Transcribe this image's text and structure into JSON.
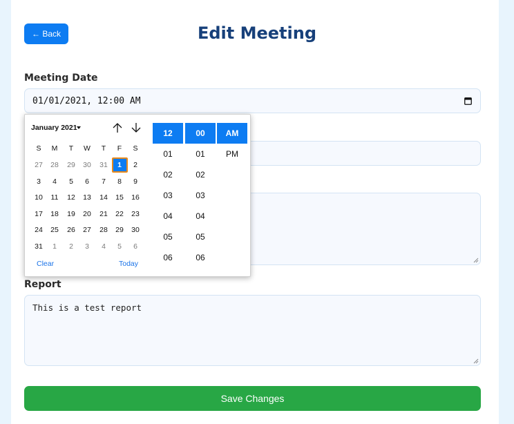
{
  "header": {
    "back_label": "← Back",
    "title": "Edit Meeting"
  },
  "form": {
    "meeting_date_label": "Meeting Date",
    "meeting_date_value": "01/01/2021, 12:00 AM",
    "report_label": "Report",
    "report_value": "This is a test report",
    "save_label": "Save Changes"
  },
  "picker": {
    "month_label": "January 2021",
    "weekdays": [
      "S",
      "M",
      "T",
      "W",
      "T",
      "F",
      "S"
    ],
    "weeks": [
      [
        {
          "d": "27",
          "o": true
        },
        {
          "d": "28",
          "o": true
        },
        {
          "d": "29",
          "o": true
        },
        {
          "d": "30",
          "o": true
        },
        {
          "d": "31",
          "o": true
        },
        {
          "d": "1",
          "s": true
        },
        {
          "d": "2"
        }
      ],
      [
        {
          "d": "3"
        },
        {
          "d": "4"
        },
        {
          "d": "5"
        },
        {
          "d": "6"
        },
        {
          "d": "7"
        },
        {
          "d": "8"
        },
        {
          "d": "9"
        }
      ],
      [
        {
          "d": "10"
        },
        {
          "d": "11"
        },
        {
          "d": "12"
        },
        {
          "d": "13"
        },
        {
          "d": "14"
        },
        {
          "d": "15"
        },
        {
          "d": "16"
        }
      ],
      [
        {
          "d": "17"
        },
        {
          "d": "18"
        },
        {
          "d": "19"
        },
        {
          "d": "20"
        },
        {
          "d": "21"
        },
        {
          "d": "22"
        },
        {
          "d": "23"
        }
      ],
      [
        {
          "d": "24"
        },
        {
          "d": "25"
        },
        {
          "d": "26"
        },
        {
          "d": "27"
        },
        {
          "d": "28"
        },
        {
          "d": "29"
        },
        {
          "d": "30"
        }
      ],
      [
        {
          "d": "31"
        },
        {
          "d": "1",
          "o": true
        },
        {
          "d": "2",
          "o": true
        },
        {
          "d": "3",
          "o": true
        },
        {
          "d": "4",
          "o": true
        },
        {
          "d": "5",
          "o": true
        },
        {
          "d": "6",
          "o": true
        }
      ]
    ],
    "clear_label": "Clear",
    "today_label": "Today",
    "hours": [
      "12",
      "01",
      "02",
      "03",
      "04",
      "05",
      "06"
    ],
    "minutes": [
      "00",
      "01",
      "02",
      "03",
      "04",
      "05",
      "06"
    ],
    "meridiem": [
      "AM",
      "PM"
    ],
    "selected_hour": "12",
    "selected_minute": "00",
    "selected_meridiem": "AM"
  },
  "colors": {
    "accent": "#0d7cf2",
    "title": "#17407a",
    "save": "#28a745",
    "today_ring": "#e8891a"
  }
}
